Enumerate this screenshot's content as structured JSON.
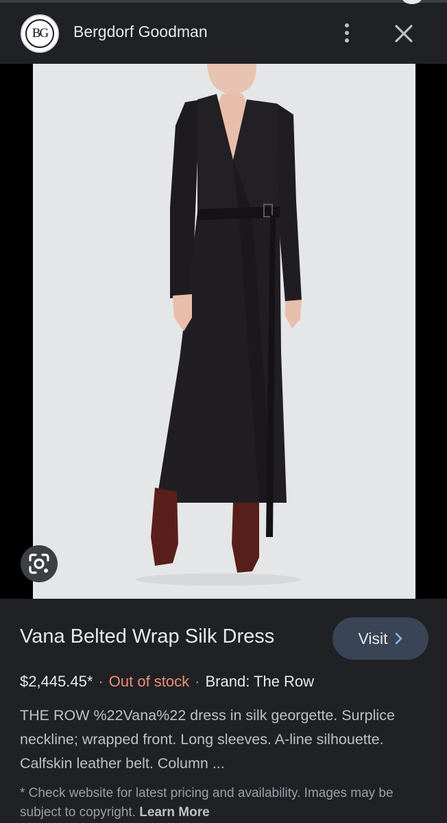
{
  "header": {
    "logo_text": "BG",
    "site_name": "Bergdorf Goodman"
  },
  "product": {
    "title": "Vana Belted Wrap Silk Dress",
    "visit_label": "Visit",
    "price": "$2,445.45*",
    "separator": "·",
    "stock_status": "Out of stock",
    "brand": "Brand: The Row",
    "description": "THE ROW %22Vana%22 dress in silk georgette. Surplice neckline; wrapped front. Long sleeves. A-line silhouette. Calfskin leather belt. Column ...",
    "disclaimer": "* Check website for latest pricing and availability. Images may be subject to copyright.",
    "learn_more": "Learn More"
  },
  "icons": {
    "menu": "more-vert-icon",
    "close": "close-icon",
    "lens": "google-lens-icon",
    "visit_arrow": "chevron-right-icon"
  },
  "colors": {
    "background": "#202124",
    "stock_status": "#ee8c7b",
    "visit_button": "#394457",
    "photo_background": "#e5e6e8"
  }
}
